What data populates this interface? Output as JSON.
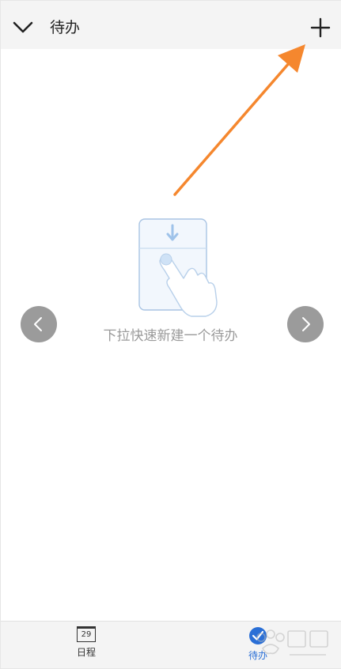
{
  "header": {
    "title": "待办"
  },
  "main": {
    "empty_hint": "下拉快速新建一个待办"
  },
  "bottom_nav": {
    "tabs": [
      {
        "label": "日程",
        "icon_text": "29"
      },
      {
        "label": "待办"
      }
    ]
  },
  "icons": {
    "back": "chevron-down-icon",
    "add": "plus-icon",
    "prev": "chevron-left-icon",
    "next": "chevron-right-icon",
    "schedule": "calendar-icon",
    "todo": "checkmark-icon"
  },
  "colors": {
    "annotation_arrow": "#f5872e",
    "active_tab": "#2a6fd6",
    "nav_button": "#9b9b9b",
    "hint_text": "#9a9a9a"
  }
}
